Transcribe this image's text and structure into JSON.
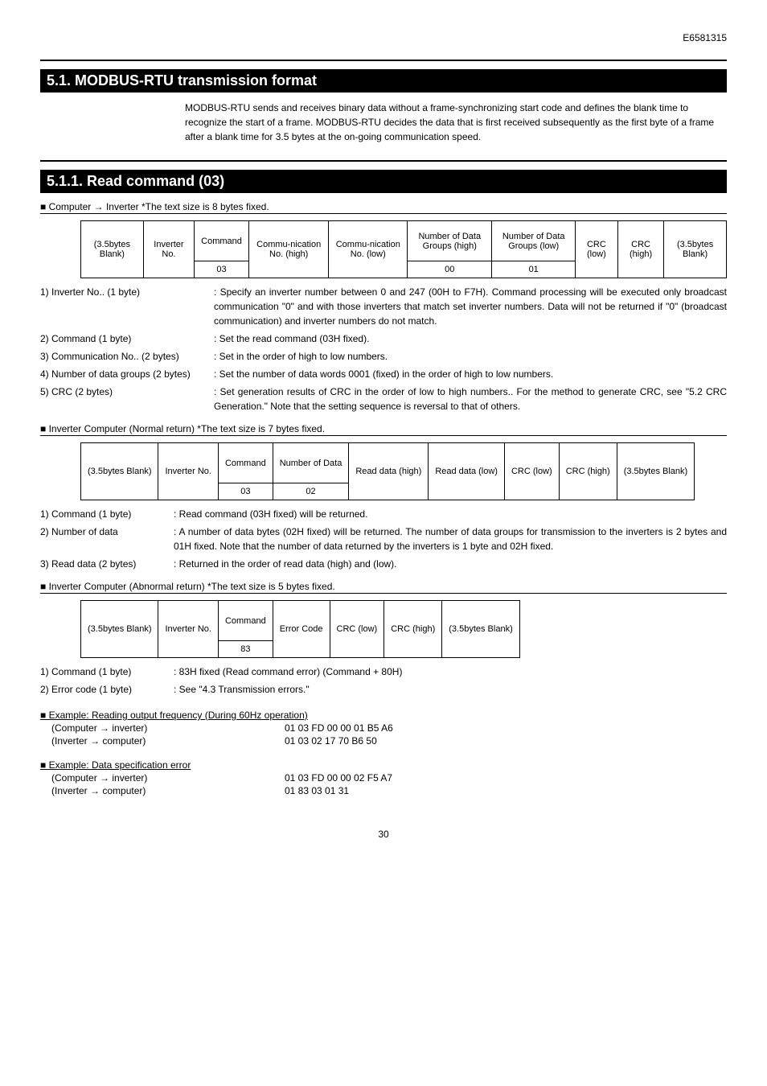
{
  "doc_id": "E6581315",
  "section51_title": "5.1.  MODBUS-RTU    transmission format",
  "section51_body": "MODBUS-RTU sends and receives binary data without a frame-synchronizing start code and defines the blank time to recognize the start of a frame.   MODBUS-RTU decides the data that is first received subsequently as the first byte of a frame after a blank time for 3.5 bytes at the on-going communication speed.",
  "section511_title": "5.1.1.  Read command (03)",
  "sub_comp_inv": "■ Computer → Inverter    *The text size is 8 bytes fixed.",
  "t1": {
    "c0": "(3.5bytes Blank)",
    "c1": "Inverter No.",
    "c2": "Command",
    "c3": "Commu-nication No. (high)",
    "c4": "Commu-nication No. (low)",
    "c5": "Number of Data Groups (high)",
    "c6": "Number of Data Groups (low)",
    "c7": "CRC (low)",
    "c8": "CRC (high)",
    "c9": "(3.5bytes Blank)",
    "r2c2": "03",
    "r2c5": "00",
    "r2c6": "01"
  },
  "d1": {
    "l1": "1) Inverter No.. (1 byte)",
    "v1": ": Specify an inverter number between 0 and 247 (00H to F7H). Command processing will be executed only broadcast communication \"0\" and with those inverters that match set inverter numbers.   Data will not be returned if \"0\" (broadcast communication) and inverter numbers do not match.",
    "l2": "2) Command (1 byte)",
    "v2": ": Set the read command (03H fixed).",
    "l3": "3) Communication No.. (2 bytes)",
    "v3": ": Set in the order of high to low numbers.",
    "l4": "4) Number of data groups (2 bytes)",
    "v4": ": Set the number of data words 0001 (fixed) in the order of high to low numbers.",
    "l5": "5) CRC (2 bytes)",
    "v5": ": Set generation results of CRC in the order of low to high numbers..  For the method to generate CRC, see \"5.2 CRC Generation.\"   Note that the setting sequence is reversal to that of others."
  },
  "sub_inv_norm": "■ Inverter         Computer (Normal return)    *The text size is 7 bytes fixed.",
  "t2": {
    "c0": "(3.5bytes Blank)",
    "c1": "Inverter No.",
    "c2": "Command",
    "c3": "Number of Data",
    "c4": "Read data (high)",
    "c5": "Read data (low)",
    "c6": "CRC (low)",
    "c7": "CRC (high)",
    "c8": "(3.5bytes Blank)",
    "r2c2": "03",
    "r2c3": "02"
  },
  "d2": {
    "l1": "1) Command (1 byte)",
    "v1": ": Read command (03H fixed) will be returned.",
    "l2": "2) Number of data",
    "v2": ": A number of data bytes (02H fixed) will be returned.   The number of data groups for transmission to the inverters is 2 bytes and 01H fixed.   Note that the number of data returned by the inverters is 1 byte and 02H fixed.",
    "l3": "3) Read data (2 bytes)",
    "v3": ": Returned in the order of read data (high) and (low)."
  },
  "sub_inv_abn": "■ Inverter         Computer (Abnormal return)    *The text size is 5 bytes fixed.",
  "t3": {
    "c0": "(3.5bytes Blank)",
    "c1": "Inverter No.",
    "c2": "Command",
    "c3": "Error Code",
    "c4": "CRC (low)",
    "c5": "CRC (high)",
    "c6": "(3.5bytes Blank)",
    "r2c2": "83"
  },
  "d3": {
    "l1": "1) Command (1 byte)",
    "v1": ": 83H fixed (Read command error) (Command + 80H)",
    "l2": "2) Error code (1 byte)",
    "v2": ": See \"4.3 Transmission errors.\""
  },
  "ex1_title": "■ Example: Reading output frequency    (During 60Hz operation)",
  "ex1_r1_dir": "(Computer → inverter)",
  "ex1_r1_hex": "01 03 FD 00 00 01 B5 A6",
  "ex1_r2_dir": "(Inverter → computer)",
  "ex1_r2_hex": "01 03 02 17 70 B6 50",
  "ex2_title": "■ Example: Data specification error",
  "ex2_r1_dir": "(Computer → inverter)",
  "ex2_r1_hex": "01 03 FD 00 00 02 F5 A7",
  "ex2_r2_dir": "(Inverter → computer)",
  "ex2_r2_hex": "01 83 03 01 31",
  "page": "30"
}
